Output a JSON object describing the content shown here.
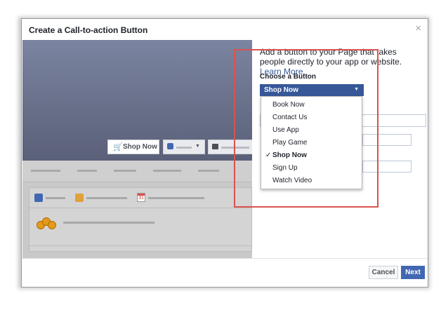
{
  "dialog": {
    "title": "Create a Call-to-action Button",
    "close_icon": "close-icon"
  },
  "preview": {
    "cta_label": "Shop Now",
    "cta_icon": "cart-icon",
    "calendar_day": "31"
  },
  "panel": {
    "intro_text": "Add a button to your Page that takes people directly to your app or website.",
    "learn_more": "Learn More.",
    "choose_label": "Choose a Button",
    "selected": "Shop Now",
    "options": [
      {
        "label": "Book Now",
        "selected": false
      },
      {
        "label": "Contact Us",
        "selected": false
      },
      {
        "label": "Use App",
        "selected": false
      },
      {
        "label": "Play Game",
        "selected": false
      },
      {
        "label": "Shop Now",
        "selected": true
      },
      {
        "label": "Sign Up",
        "selected": false
      },
      {
        "label": "Watch Video",
        "selected": false
      }
    ],
    "check_mark": "✓"
  },
  "footer": {
    "cancel_label": "Cancel",
    "next_label": "Next"
  },
  "colors": {
    "accent": "#4267b2",
    "select_bg": "#365899",
    "highlight": "#d9534f"
  }
}
